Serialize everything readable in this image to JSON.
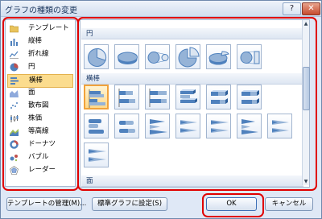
{
  "window": {
    "title": "グラフの種類の変更",
    "help_icon": "?",
    "close_icon": "✕"
  },
  "categories": [
    {
      "label": "テンプレート",
      "icon": "folder-icon"
    },
    {
      "label": "縦棒",
      "icon": "column-chart-icon"
    },
    {
      "label": "折れ線",
      "icon": "line-chart-icon"
    },
    {
      "label": "円",
      "icon": "pie-chart-icon"
    },
    {
      "label": "横棒",
      "icon": "bar-chart-icon",
      "selected": true
    },
    {
      "label": "面",
      "icon": "area-chart-icon"
    },
    {
      "label": "散布図",
      "icon": "scatter-chart-icon"
    },
    {
      "label": "株価",
      "icon": "stock-chart-icon"
    },
    {
      "label": "等高線",
      "icon": "surface-chart-icon"
    },
    {
      "label": "ドーナツ",
      "icon": "doughnut-chart-icon"
    },
    {
      "label": "バブル",
      "icon": "bubble-chart-icon"
    },
    {
      "label": "レーダー",
      "icon": "radar-chart-icon"
    }
  ],
  "gallery": {
    "sections": [
      {
        "title": "円"
      },
      {
        "title": "横棒"
      },
      {
        "title": "面"
      }
    ]
  },
  "buttons": {
    "manage_templates": "テンプレートの管理(M)...",
    "set_default": "標準グラフに設定(S)",
    "ok": "OK",
    "cancel": "キャンセル"
  },
  "colors": {
    "highlight": "#e00000",
    "selected_fill": "#fbdc8e",
    "accent": "#4f81bd"
  }
}
